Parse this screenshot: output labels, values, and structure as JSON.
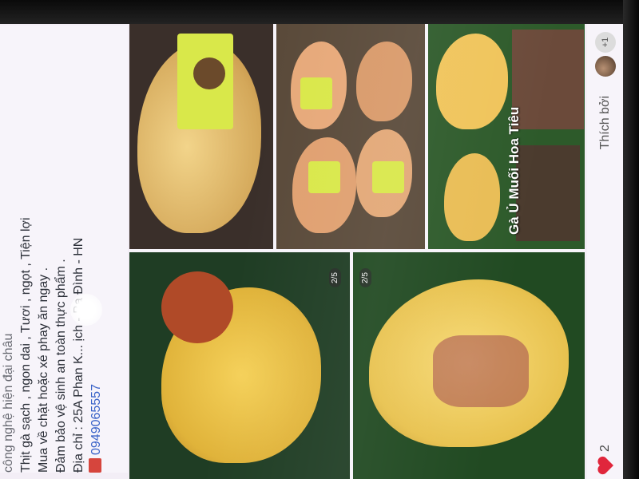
{
  "post": {
    "lines": [
      "công nghệ hiện đại châu",
      "Thịt gà sạch , ngon dai , Tươi , ngọt , Tiện lợi",
      "Mua về chặt hoặc xé phay ăn ngay .",
      "Đảm bảo vệ sinh an toàn thực phẩm .",
      "Địa chỉ : 25A Phan K... ịch - Ba Đình - HN",
      "0949065557"
    ]
  },
  "photos": {
    "overlay_title": "Gà Ủ Muối Hoa Tiêu",
    "pager_1": "2/5",
    "pager_2": "2/5"
  },
  "reactions": {
    "count": "2",
    "liked_by": "Thích bởi",
    "plus_count": "+1"
  },
  "colors": {
    "heart": "#e0263c",
    "link": "#3a63c8"
  }
}
